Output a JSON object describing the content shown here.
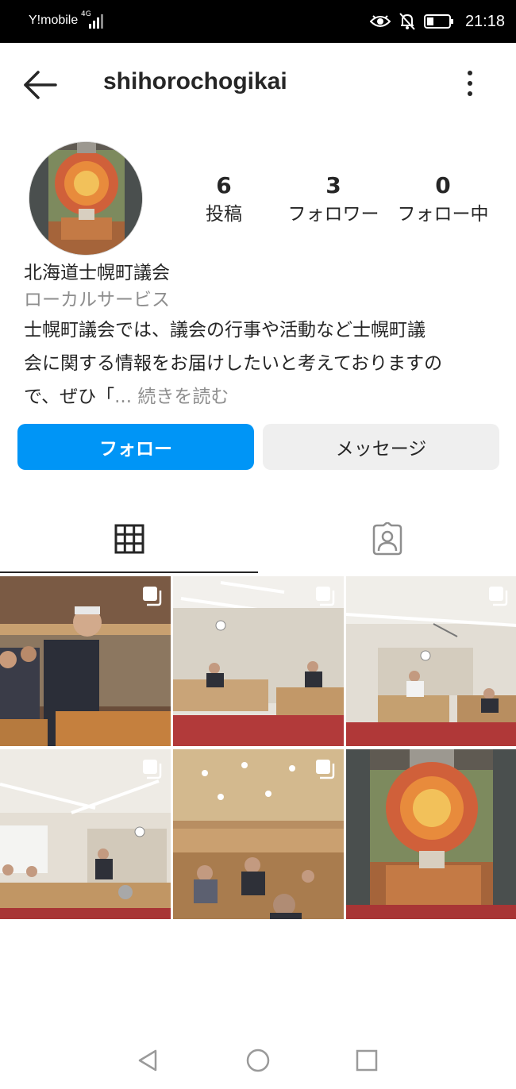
{
  "status_bar": {
    "carrier": "Y!mobile",
    "network": "4G",
    "time": "21:18",
    "icons": [
      "signal-icon",
      "eye-icon",
      "notifications-off-icon",
      "battery-icon"
    ]
  },
  "header": {
    "username": "shihorochogikai",
    "icons": [
      "back-arrow-icon",
      "more-vertical-icon"
    ]
  },
  "profile": {
    "stats": [
      {
        "value": "6",
        "label": "投稿"
      },
      {
        "value": "3",
        "label": "フォロワー"
      },
      {
        "value": "0",
        "label": "フォロー中"
      }
    ],
    "name": "北海道士幌町議会",
    "category": "ローカルサービス",
    "bio_line1": "士幌町議会では、議会の行事や活動など士幌町議",
    "bio_line2": "会に関する情報をお届けしたいと考えておりますの",
    "bio_line3": "で、ぜひ「",
    "bio_more": "... 続きを読む"
  },
  "buttons": {
    "follow": "フォロー",
    "message": "メッセージ"
  },
  "tabs": {
    "items": [
      "grid-icon",
      "tagged-person-icon"
    ],
    "active": "grid"
  },
  "posts": {
    "count": 6,
    "multi_photo": [
      true,
      true,
      true,
      true,
      true,
      false
    ]
  },
  "colors": {
    "accent": "#0095f6",
    "secondary_button": "#efefef",
    "muted_text": "#8e8e8e",
    "text": "#262626",
    "status_bar": "#000000"
  }
}
